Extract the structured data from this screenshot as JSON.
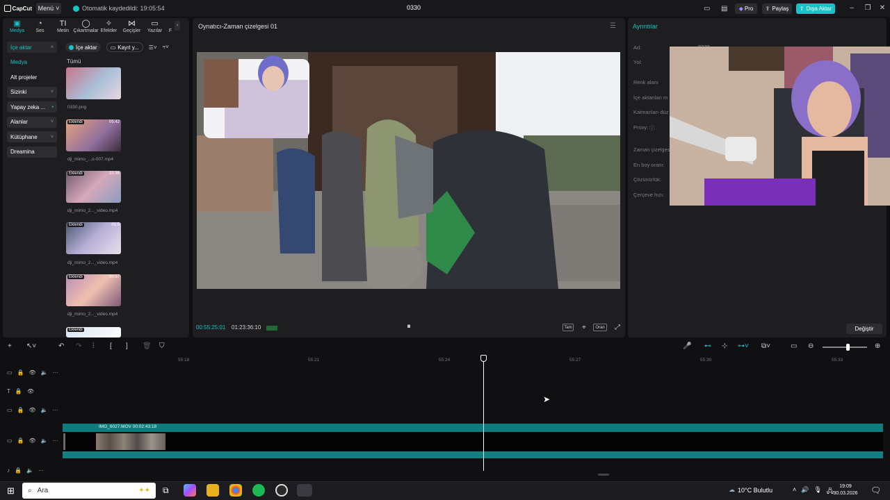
{
  "titlebar": {
    "app_name": "CapCut",
    "menu_label": "Menü",
    "autosave_text": "Otomatik kaydedildi: 19:05:54",
    "project_title": "0330",
    "pro_label": "Pro",
    "share_label": "Paylaş",
    "export_label": "Dışa Aktar"
  },
  "tool_tabs": [
    {
      "label": "Medya",
      "icon": "media-icon"
    },
    {
      "label": "Ses",
      "icon": "audio-icon"
    },
    {
      "label": "Metin",
      "icon": "text-icon"
    },
    {
      "label": "Çıkartmalar",
      "icon": "sticker-icon"
    },
    {
      "label": "Efektler",
      "icon": "effects-icon"
    },
    {
      "label": "Geçişler",
      "icon": "transitions-icon"
    },
    {
      "label": "Yazılar",
      "icon": "captions-icon"
    },
    {
      "label": "F",
      "icon": "filters-icon"
    }
  ],
  "sidebar": {
    "items": [
      {
        "label": "İçe aktar",
        "chevron": "˄"
      },
      {
        "label": "Medya",
        "chevron": ""
      },
      {
        "label": "Alt projeler",
        "chevron": ""
      },
      {
        "label": "Sizinki",
        "chevron": "˅"
      },
      {
        "label": "Yapay zeka ...",
        "chevron": "•"
      },
      {
        "label": "Alanlar",
        "chevron": "˅"
      },
      {
        "label": "Kütüphane",
        "chevron": "˅"
      },
      {
        "label": "Dreamina",
        "chevron": ""
      }
    ]
  },
  "media": {
    "import_label": "İçe aktar",
    "record_label": "Kayıt y...",
    "all_label": "Tümü",
    "added_badge": "Eklendi",
    "items": [
      {
        "name": "0330.png",
        "duration": ""
      },
      {
        "name": "dji_mimo_...o-007.mp4",
        "duration": "05:42"
      },
      {
        "name": "dji_mimo_2..._video.mp4",
        "duration": "21:36"
      },
      {
        "name": "dji_mimo_2..._video.mp4",
        "duration": "01:5"
      },
      {
        "name": "dji_mimo_2..._video.mp4",
        "duration": "00:57"
      }
    ]
  },
  "player": {
    "title": "Oynatıcı-Zaman çizelgesi 01",
    "current_time": "00:55:25:01",
    "total_time": "01:23:36:10",
    "full_label": "Tam",
    "ratio_label": "Oran"
  },
  "details": {
    "title": "Ayrıntılar",
    "labels": [
      "Ad:",
      "Yol:",
      "Renk alanı",
      "İçe aktarılan m",
      "Katmanları düz",
      "Proxy:",
      "Zaman çizelges",
      "En boy oranı:",
      "Çözünürlük:",
      "Çerçeve hızı:"
    ],
    "name_value": "0330",
    "change_label": "Değiştir"
  },
  "timeline": {
    "ticks": [
      "55:18",
      "55:21",
      "55:24",
      "55:27",
      "55:30",
      "55:33"
    ],
    "clip_label": "IMG_6027.MOV  00:02:43:18"
  },
  "taskbar": {
    "search_placeholder": "Ara",
    "weather": "10°C  Bulutlu",
    "time": "19:09",
    "date": "30.03.2026"
  },
  "colors": {
    "accent": "#18c3c8",
    "panel": "#1e1e21",
    "background": "#101012"
  }
}
